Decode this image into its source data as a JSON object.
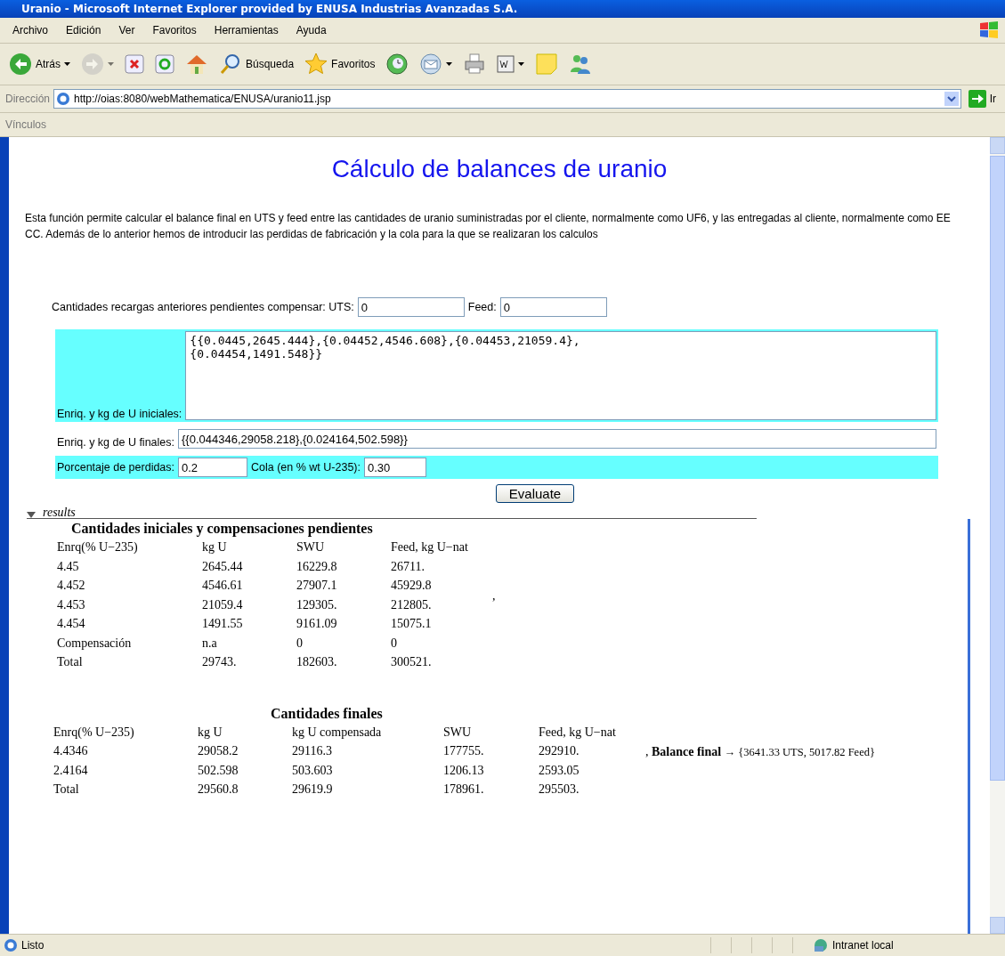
{
  "window": {
    "title": "Uranio - Microsoft Internet Explorer provided by ENUSA Industrias Avanzadas S.A."
  },
  "menu": [
    "Archivo",
    "Edición",
    "Ver",
    "Favoritos",
    "Herramientas",
    "Ayuda"
  ],
  "toolbar": [
    {
      "kind": "back",
      "label": "Atrás",
      "dropdown": true,
      "disabled": false
    },
    {
      "kind": "forward",
      "dropdown": true,
      "disabled": true
    },
    {
      "kind": "stop",
      "dropdown": false,
      "disabled": false
    },
    {
      "kind": "refresh",
      "dropdown": false,
      "disabled": false
    },
    {
      "kind": "home",
      "dropdown": false,
      "disabled": false
    },
    {
      "kind": "search",
      "label": "Búsqueda",
      "dropdown": false,
      "disabled": false
    },
    {
      "kind": "favorites",
      "label": "Favoritos",
      "dropdown": false,
      "disabled": false
    },
    {
      "kind": "history",
      "dropdown": false,
      "disabled": false
    },
    {
      "kind": "mail",
      "dropdown": true,
      "disabled": false
    },
    {
      "kind": "print",
      "dropdown": false,
      "disabled": false
    },
    {
      "kind": "word",
      "dropdown": true,
      "disabled": false
    },
    {
      "kind": "notes",
      "dropdown": false,
      "disabled": false
    },
    {
      "kind": "messenger",
      "dropdown": false,
      "disabled": false
    }
  ],
  "address": {
    "label": "Dirección",
    "url": "http://oias:8080/webMathematica/ENUSA/uranio11.jsp",
    "go": "Ir"
  },
  "links_bar": {
    "label": "Vínculos"
  },
  "page": {
    "title": "Cálculo de balances de uranio",
    "description": "Esta función permite calcular el balance final en UTS y feed entre las cantidades de uranio suministradas por el cliente, normalmente como UF6, y las entregadas al cliente, normalmente como EE CC. Además de lo anterior hemos de introducir las perdidas de fabricación y la cola para la que se realizaran los calculos",
    "pending_label": "Cantidades recargas anteriores pendientes compensar: UTS:",
    "uts": "0",
    "feed_label": "Feed:",
    "feed": "0",
    "initial_label": "Enriq. y kg de U iniciales:",
    "initial": "{{0.0445,2645.444},{0.04452,4546.608},{0.04453,21059.4},\n{0.04454,1491.548}}",
    "final_label": "Enriq. y kg de U finales:",
    "final": "{{0.044346,29058.218},{0.024164,502.598}}",
    "losses_label": "Porcentaje de perdidas:",
    "losses": "0.2",
    "tail_label": "Cola (en % wt U-235):",
    "tail": "0.30",
    "button": "Evaluate"
  },
  "results": {
    "label": "results",
    "table_1": {
      "title": "Cantidades iniciales y compensaciones pendientes",
      "columns": [
        "Enrq(% U−235)",
        "kg U",
        "SWU",
        "Feed, kg U−nat"
      ],
      "rows": [
        [
          "4.45",
          "2645.44",
          "16229.8",
          "26711."
        ],
        [
          "4.452",
          "4546.61",
          "27907.1",
          "45929.8"
        ],
        [
          "4.453",
          "21059.4",
          "129305.",
          "212805."
        ],
        [
          "4.454",
          "1491.55",
          "9161.09",
          "15075.1"
        ],
        [
          "Compensación",
          "n.a",
          "0",
          "0"
        ],
        [
          "Total",
          "29743.",
          "182603.",
          "300521."
        ]
      ],
      "separator": ","
    },
    "table_2": {
      "title": "Cantidades finales",
      "columns": [
        "Enrq(% U−235)",
        "kg U",
        "kg U compensada",
        "SWU",
        "Feed, kg U−nat"
      ],
      "rows": [
        [
          "4.4346",
          "29058.2",
          "29116.3",
          "177755.",
          "292910."
        ],
        [
          "2.4164",
          "502.598",
          "503.603",
          "1206.13",
          "2593.05"
        ],
        [
          "Total",
          "29560.8",
          "29619.9",
          "178961.",
          "295503."
        ]
      ]
    },
    "balance": {
      "prefix": ",",
      "label": "Balance final",
      "value": "→ {3641.33 UTS, 5017.82 Feed}"
    }
  },
  "status_bar": {
    "text": "Listo",
    "zone": "Intranet local"
  }
}
